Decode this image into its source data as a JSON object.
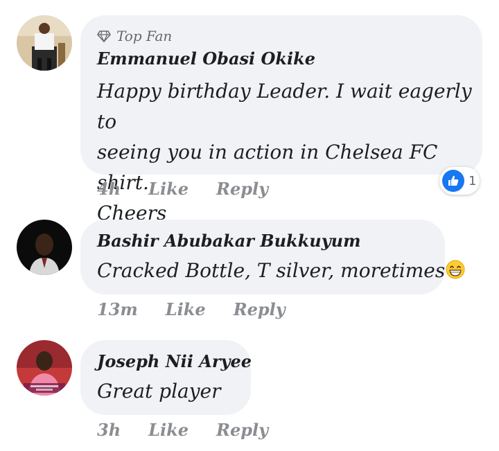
{
  "comments": [
    {
      "badge": "Top Fan",
      "author": "Emmanuel Obasi Okike",
      "text_lines": [
        "Happy birthday Leader. I wait eagerly to",
        "seeing you in action in Chelsea FC shirt.",
        "Cheers"
      ],
      "time": "4h",
      "like_label": "Like",
      "reply_label": "Reply",
      "reaction_count": "1",
      "reaction_icon": "like-icon"
    },
    {
      "author": "Bashir Abubakar Bukkuyum",
      "text": "Cracked Bottle, T silver, moretimes",
      "emoji": "grinning-face-icon",
      "time": "13m",
      "like_label": "Like",
      "reply_label": "Reply"
    },
    {
      "author": "Joseph Nii Aryee",
      "text": "Great player",
      "time": "3h",
      "like_label": "Like",
      "reply_label": "Reply"
    }
  ],
  "colors": {
    "bubble": "#f0f2f5",
    "like_blue": "#1877f2",
    "meta_gray": "#8a8d91"
  }
}
